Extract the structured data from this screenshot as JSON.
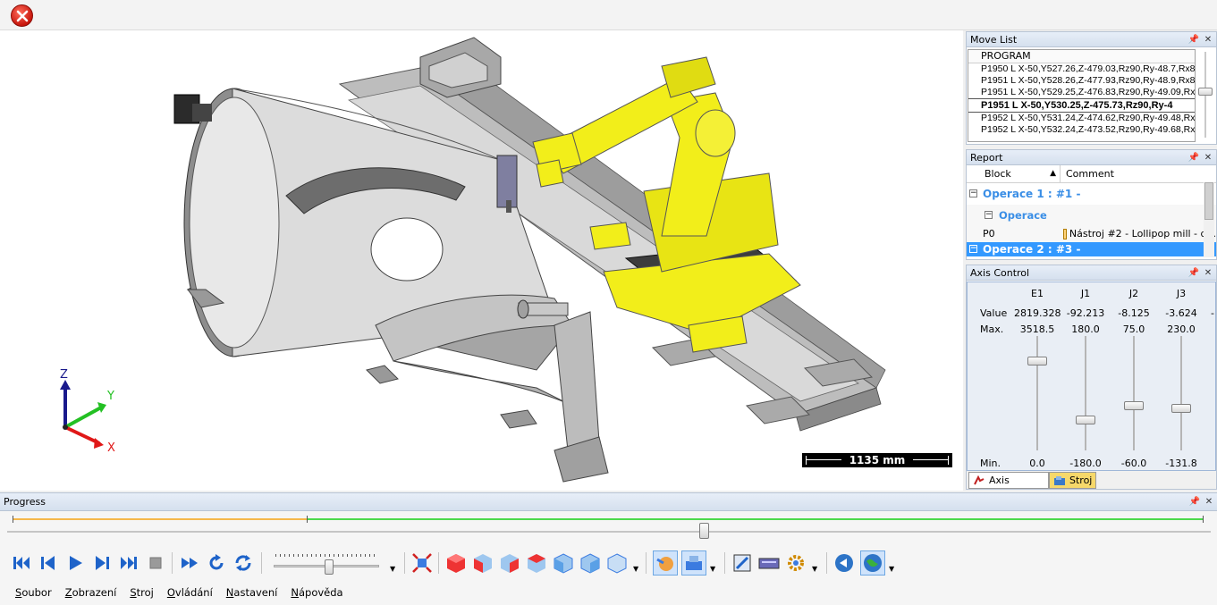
{
  "topbar": {
    "close_icon": "close-icon"
  },
  "viewport": {
    "scale_label": "1135 mm",
    "axes": {
      "z": "Z",
      "y": "Y",
      "x": "X"
    }
  },
  "movelist": {
    "title": "Move List",
    "column": "PROGRAM",
    "rows": [
      "P1950 L X-50,Y527.26,Z-479.03,Rz90,Ry-48.7,Rx8",
      "P1951 L X-50,Y528.26,Z-477.93,Rz90,Ry-48.9,Rx8",
      "P1951 L X-50,Y529.25,Z-476.83,Rz90,Ry-49.09,Rx",
      "P1951 L X-50,Y530.25,Z-475.73,Rz90,Ry-4",
      "P1952 L X-50,Y531.24,Z-474.62,Rz90,Ry-49.48,Rx",
      "P1952 L X-50,Y532.24,Z-473.52,Rz90,Ry-49.68,Rx"
    ],
    "selected_index": 3
  },
  "report": {
    "title": "Report",
    "col_block": "Block",
    "col_comment": "Comment",
    "op1": "Operace 1 : #1 -",
    "sub": "Operace",
    "p0_block": "P0",
    "p0_comment": "Nástroj #2 - Lollipop mill - d...",
    "op2": "Operace 2 : #3 -"
  },
  "axis_control": {
    "title": "Axis Control",
    "row_value": "Value",
    "row_max": "Max.",
    "row_min": "Min.",
    "axes": [
      {
        "name": "E1",
        "value": "2819.328",
        "max": "3518.5",
        "min": "0.0",
        "level": 0.801
      },
      {
        "name": "J1",
        "value": "-92.213",
        "max": "180.0",
        "min": "-180.0",
        "level": 0.244
      },
      {
        "name": "J2",
        "value": "-8.125",
        "max": "75.0",
        "min": "-60.0",
        "level": 0.384
      },
      {
        "name": "J3",
        "value": "-3.624",
        "max": "230.0",
        "min": "-131.8",
        "level": 0.354
      }
    ],
    "extra_value": "-",
    "tabs": [
      "Axis Control",
      "Stroj"
    ]
  },
  "progress": {
    "title": "Progress",
    "done_fraction": 0.247,
    "scrubber_fraction": 0.58
  },
  "menubar": {
    "items": [
      {
        "accel": "S",
        "rest": "oubor"
      },
      {
        "accel": "Z",
        "rest": "obrazení"
      },
      {
        "accel": "S",
        "rest": "troj"
      },
      {
        "accel": "O",
        "rest": "vládání"
      },
      {
        "accel": "N",
        "rest": "astavení"
      },
      {
        "accel": "N",
        "rest": "ápověda"
      }
    ]
  },
  "colors": {
    "robot": "#f2ee1a",
    "machine": "#c8c8c8",
    "selection": "#3399ff",
    "link": "#3a8ee6",
    "progress_done": "#f5b74a",
    "progress_rest": "#4cd94c"
  }
}
